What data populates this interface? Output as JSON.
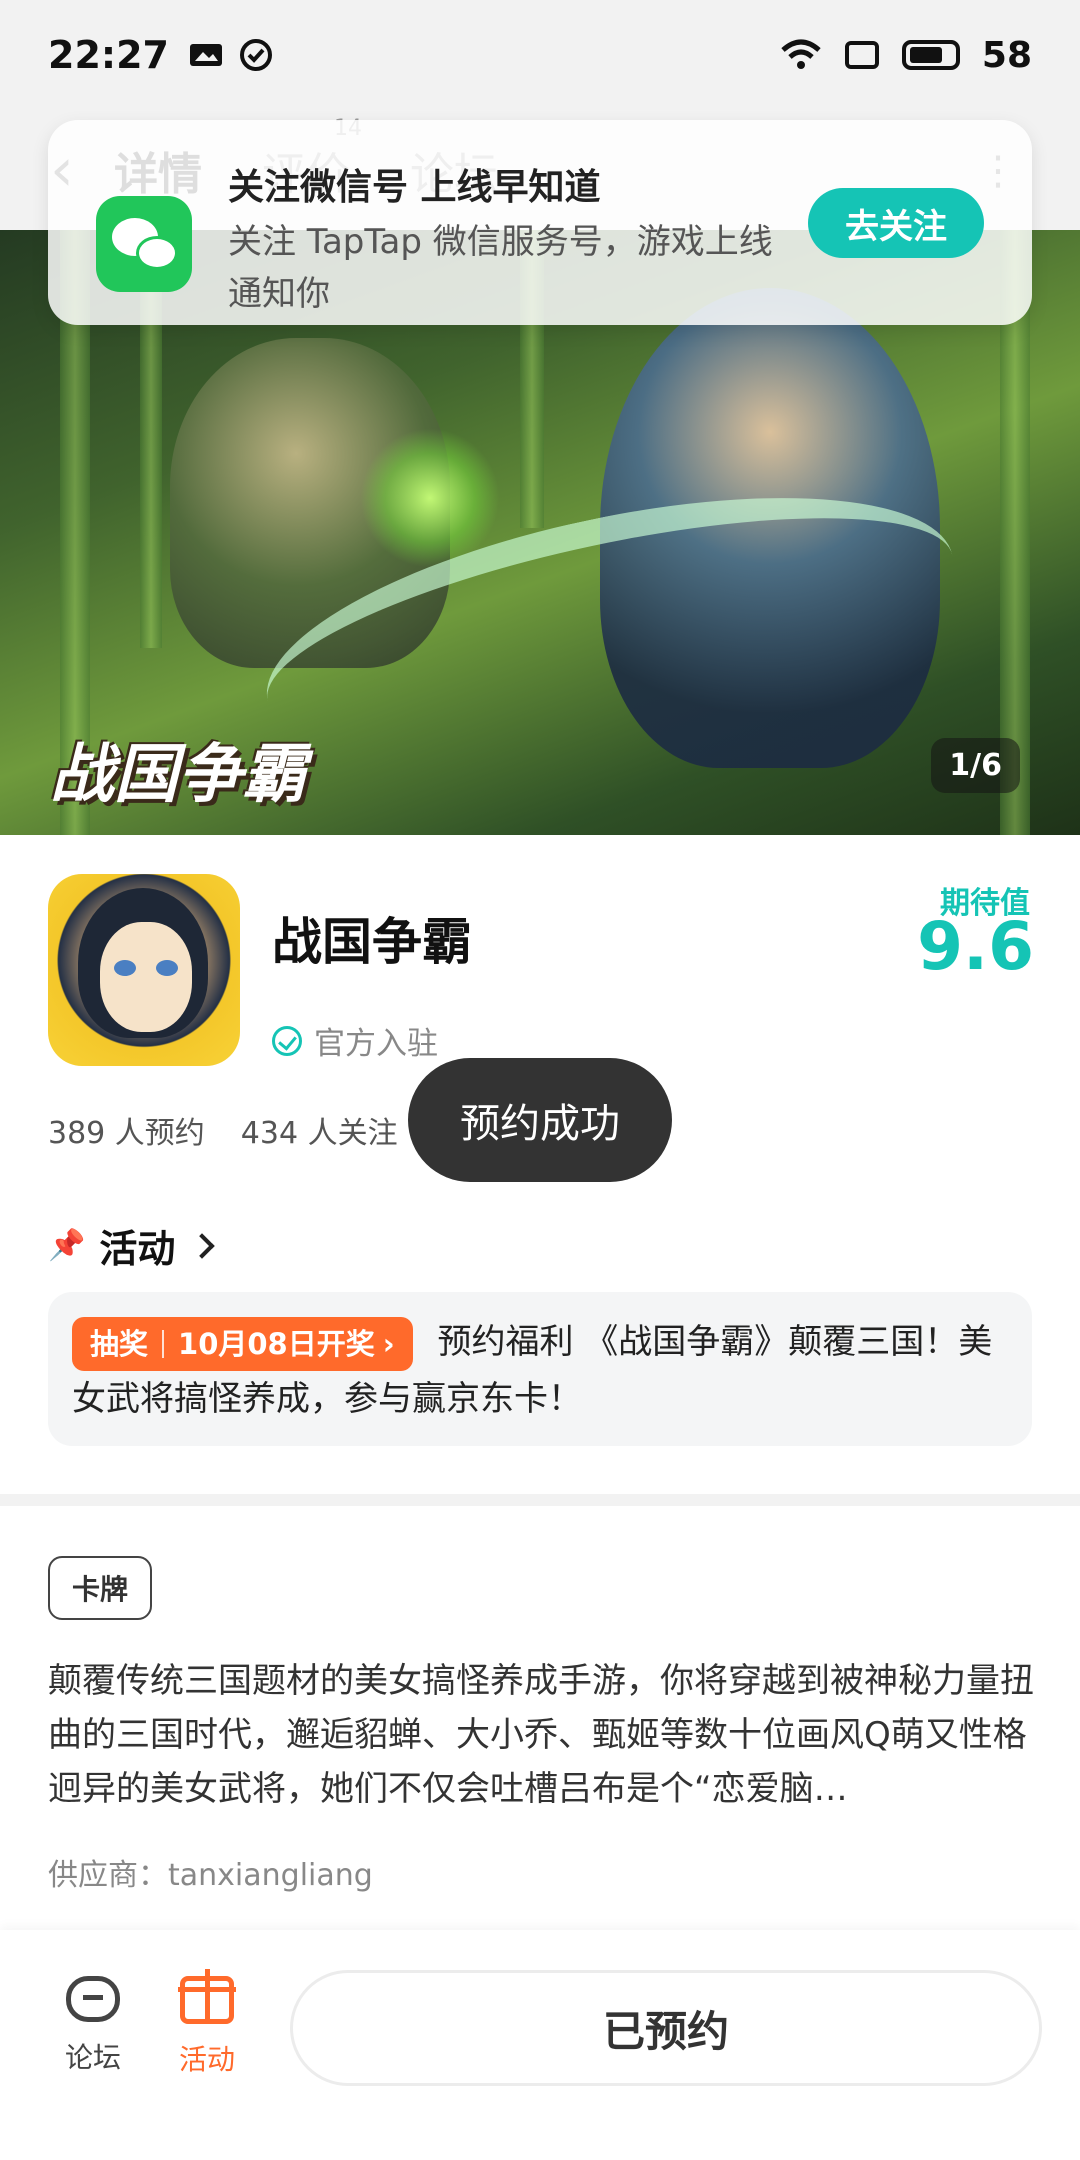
{
  "status_bar": {
    "time": "22:27",
    "battery": "58"
  },
  "top_nav": {
    "tabs": [
      {
        "label": "详情"
      },
      {
        "label": "评价",
        "badge": "14"
      },
      {
        "label": "论坛"
      }
    ]
  },
  "notice": {
    "title": "关注微信号 上线早知道",
    "body": "关注 TapTap 微信服务号，游戏上线通知你",
    "button": "去关注"
  },
  "hero": {
    "logo_text": "战国争霸",
    "counter": "1/6"
  },
  "game": {
    "title": "战国争霸",
    "official_label": "官方入驻",
    "expect_label": "期待值",
    "expect_value": "9.6",
    "reservations": "389 人预约",
    "follows": "434 人关注"
  },
  "toast": "预约成功",
  "activity": {
    "section_title": "活动",
    "tag_left": "抽奖",
    "tag_right": "10月08日开奖",
    "text": "预约福利 《战国争霸》颠覆三国！美女武将搞怪养成，参与赢京东卡！"
  },
  "tags": [
    "卡牌"
  ],
  "description": "颠覆传统三国题材的美女搞怪养成手游，你将穿越到被神秘力量扭曲的三国时代，邂逅貂蝉、大小乔、甄姬等数十位画风Q萌又性格迥异的美女武将，她们不仅会吐槽吕布是个“恋爱脑…",
  "supplier": "供应商：tanxiangliang",
  "bottom_bar": {
    "forum_label": "论坛",
    "activity_label": "活动",
    "reserve_button": "已预约"
  },
  "colors": {
    "accent": "#15c4b5",
    "orange": "#ff6a2b",
    "wechat": "#21c65a"
  }
}
